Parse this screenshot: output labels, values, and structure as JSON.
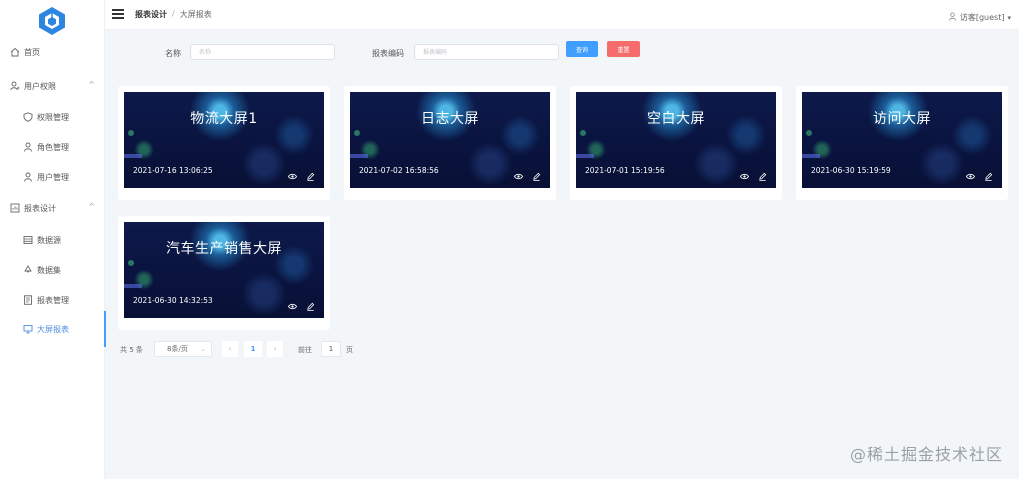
{
  "sidebar": {
    "items": [
      {
        "label": "首页",
        "icon": "home-icon",
        "level": "top"
      },
      {
        "label": "用户权限",
        "icon": "user-group-icon",
        "level": "top",
        "arrow": "^"
      },
      {
        "label": "权限管理",
        "icon": "shield-icon",
        "level": "sub"
      },
      {
        "label": "角色管理",
        "icon": "person-icon",
        "level": "sub"
      },
      {
        "label": "用户管理",
        "icon": "person-icon",
        "level": "sub"
      },
      {
        "label": "报表设计",
        "icon": "report-icon",
        "level": "top",
        "arrow": "^"
      },
      {
        "label": "数据源",
        "icon": "database-icon",
        "level": "sub"
      },
      {
        "label": "数据集",
        "icon": "recycle-icon",
        "level": "sub"
      },
      {
        "label": "报表管理",
        "icon": "document-icon",
        "level": "sub"
      },
      {
        "label": "大屏报表",
        "icon": "monitor-icon",
        "level": "sub",
        "active": true
      }
    ]
  },
  "header": {
    "breadcrumb": [
      "报表设计",
      "/",
      "大屏报表"
    ],
    "user": "访客[guest]",
    "user_caret": "▾"
  },
  "search": {
    "name_label": "名称",
    "name_placeholder": "名称",
    "code_label": "报表编码",
    "code_placeholder": "报表编码",
    "query_label": "查询",
    "reset_label": "重置"
  },
  "cards": [
    {
      "title": "物流大屏1",
      "date": "2021-07-16 13:06:25"
    },
    {
      "title": "日志大屏",
      "date": "2021-07-02 16:58:56"
    },
    {
      "title": "空白大屏",
      "date": "2021-07-01 15:19:56"
    },
    {
      "title": "访问大屏",
      "date": "2021-06-30 15:19:59"
    },
    {
      "title": "汽车生产销售大屏",
      "date": "2021-06-30 14:32:53"
    }
  ],
  "pagination": {
    "total": "共 5 条",
    "page_size": "8条/页",
    "prev": "‹",
    "current": "1",
    "next": "›",
    "goto_prefix": "前往",
    "goto_value": "1",
    "goto_suffix": "页"
  },
  "watermark": "@稀土掘金技术社区",
  "colors": {
    "primary": "#409eff",
    "danger": "#f56c6c",
    "card_bg": "#0a1440",
    "page_bg": "#f3f6f9"
  }
}
